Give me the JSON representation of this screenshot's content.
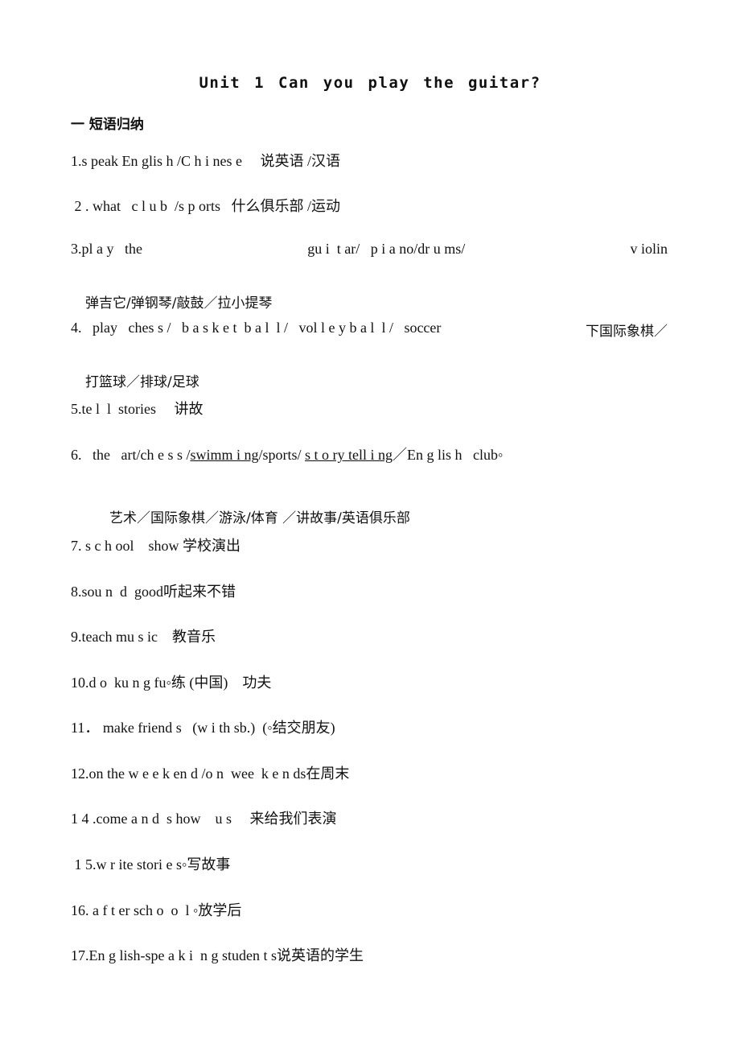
{
  "document": {
    "title": "Unit 1   Can  you play the guitar?",
    "section_heading": "一 短语归纳",
    "items": {
      "i1": "1.s peak En glis h /C h i nes e     说英语 /汉语",
      "i2": " 2 . what   c l u b  /s p orts   什么俱乐部 /运动",
      "i3": {
        "parts": [
          "3.pl a y   the",
          "gu i  t ar/   p i a no/dr u ms/",
          "v iolin"
        ],
        "cn": "弹吉它/弹钢琴/敲鼓／拉小提琴"
      },
      "i4": {
        "en": "4.   play   ches s /   b a s k e t  b a l  l /   vol l e y b a l  l /   soccer",
        "cn_end": "下国际象棋／",
        "cn": "打篮球／排球/足球"
      },
      "i5": "5.te l  l  stories     讲故",
      "i6": {
        "pre": "6.   the   art/ch e s s /",
        "u1": "swimm i ng",
        "mid": "/sports/ ",
        "u2": "s t o ry tell i ng",
        "post": "／En g lis h   club◦",
        "cn": "艺术／国际象棋／游泳/体育 ／讲故事/英语俱乐部"
      },
      "i7": "7. s c h ool    show 学校演出",
      "i8": "8.sou n  d  good听起来不错",
      "i9": "9.teach mu s ic    教音乐",
      "i10": "10.d o  ku n g fu◦练 (中国)    功夫",
      "i11": "11． make friend s   (w i th sb.)  (◦结交朋友)",
      "i12": "12.on the w e e k en d /o n  wee  k e n ds在周末",
      "i14": "1 4 .come a n d  s how    u s     来给我们表演",
      "i15": " 1 5.w r ite stori e s◦写故事",
      "i16": "16. a f t er sch o  o  l ◦放学后",
      "i17": "17.En g lish-spe a k i  n g studen t s说英语的学生"
    }
  }
}
